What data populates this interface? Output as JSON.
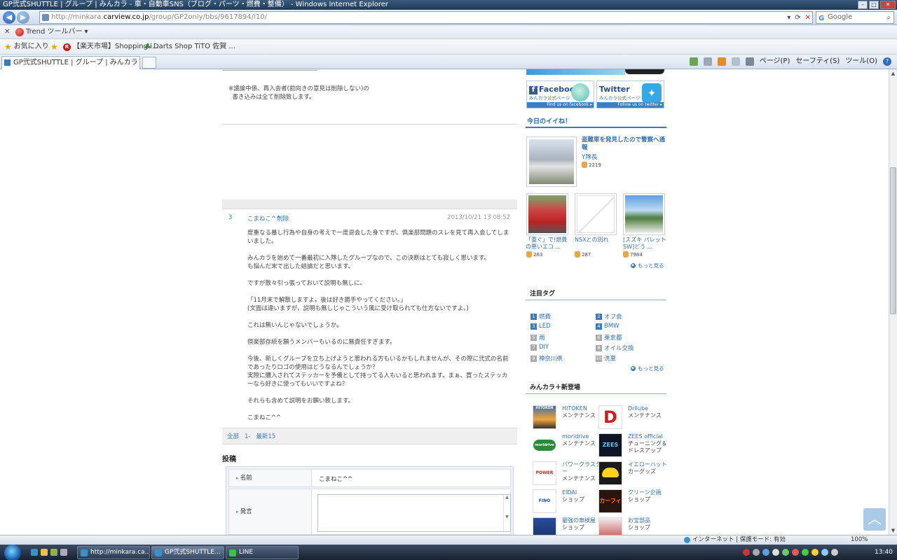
{
  "window": {
    "title": "GP弐式SHUTTLE | グループ | みんカラ - 車・自動車SNS（ブログ・パーツ・燃費・整備） - Windows Internet Explorer"
  },
  "address": {
    "url_prefix": "http://minkara.",
    "url_host": "carview.co.jp",
    "url_path": "/group/GP2only/bbs/9617894/l10/"
  },
  "search": {
    "placeholder": "Google"
  },
  "toolbar": {
    "trend": "Trend ツールバー"
  },
  "favorites": {
    "label": "お気に入り",
    "items": [
      "【楽天市場】Shopping i...",
      "Darts Shop TiTO 佐賀 ..."
    ]
  },
  "tab": {
    "title": "GP弐式SHUTTLE | グループ | みんカラ - 車・..."
  },
  "commands": [
    "ページ(P)",
    "セーフティ(S)",
    "ツール(O)"
  ],
  "notice": "※議論中係、再入会者(前向きの意見は削除しない)の\n  書き込みは全て削除致します。",
  "post": {
    "number": "3",
    "author": "こまねこ^^",
    "delete_label": "削除",
    "date": "2013/10/21 13:08:52",
    "paragraphs": [
      "度重なる暴し行為や自身の考えで一度退会した身ですが、倶楽部問題のスレを見て再入会してしまいました。",
      "みんカラを始めて一番最初に入隊したグループなので、この決断はとても寂しく思います。　　　　も悩んだ末で出した結論だと思います。",
      "ですが散々引っ張っておいて説明も無しに、",
      "「11月末で解散しますよ。後は好き勝手やってください。」\n(文面は違いますが、説明も無しじゃこういう風に受け取られても仕方ないですよ。)",
      "これは無いんじゃないでしょうか。",
      "倶楽部存続を願うメンバーもいるのに無責任すぎます。",
      "今後、新しくグループを立ち上げようと思われる方もいるかもしれませんが、その際に弐式の名前であったりロゴの使用はどうなるんでしょうか？\n実際に購入されてステッカーを予備として持ってる人もいると思われます。まぁ、買ったステッカーなら好きに使ってもいいですよね？",
      "それらも含めて説明をお願い致します。",
      "こまねこ^^"
    ]
  },
  "paging": {
    "all": "全部",
    "range": "1-",
    "latest": "最新15"
  },
  "form": {
    "title": "投稿",
    "name_label": "名前",
    "name_value": "こまねこ^^",
    "message_label": "発言"
  },
  "sidebar": {
    "facebook": {
      "name": "Facebook",
      "sub": "みんカラ公式ページ",
      "band": "Find us on facebook ▸"
    },
    "twitter": {
      "name": "Twitter",
      "sub": "みんカラ公式ページ",
      "band": "Follow us on twitter ▸"
    },
    "today_like": {
      "heading": "今日のイイね！",
      "featured": {
        "title": "盗難車を発見したので警察へ通報",
        "user": "Y隊長",
        "likes": "2219"
      },
      "items": [
        {
          "title": "「重ぐ」で!燃費の悪いエコ ...",
          "likes": "263"
        },
        {
          "title": "NSXとの別れ",
          "likes": "287"
        },
        {
          "title": "[スズキ パレットSW]どう ...",
          "likes": "7984"
        }
      ],
      "more": "もっと見る"
    },
    "tags": {
      "heading": "注目タグ",
      "items": [
        "燃費",
        "オフ会",
        "LED",
        "BMW",
        "雨",
        "東京都",
        "DIY",
        "オイル交換",
        "神奈川県",
        "洗車"
      ],
      "ranks": [
        "1",
        "2",
        "3",
        "4",
        "5",
        "6",
        "7",
        "8",
        "9",
        "10"
      ],
      "more": "もっと見る"
    },
    "new_arrivals": {
      "heading": "みんカラ＋新登場",
      "items": [
        {
          "name": "HITOKEN",
          "category": "メンテナンス"
        },
        {
          "name": "Drilube",
          "category": "メンテナンス"
        },
        {
          "name": "moridrive",
          "category": "メンテナンス"
        },
        {
          "name": "ZEES official",
          "category": "チューニング＆ドレスアップ"
        },
        {
          "name": "パワークラスター",
          "category": "メンテナンス"
        },
        {
          "name": "イエローハット",
          "category": "カーグッズ"
        },
        {
          "name": "EIDAI",
          "category": "ショップ"
        },
        {
          "name": "クリーン企画",
          "category": "ショップ"
        },
        {
          "name": "最強の車検屋",
          "category": "ショップ"
        },
        {
          "name": "お宝部品",
          "category": "ショップ"
        }
      ]
    }
  },
  "status": {
    "zone": "インターネット | 保護モード: 有効",
    "zoom": "100%"
  },
  "taskbar": {
    "items": [
      "http://minkara.ca...",
      "GP弐式SHUTTLE...",
      "LINE"
    ],
    "time": "13:40"
  }
}
